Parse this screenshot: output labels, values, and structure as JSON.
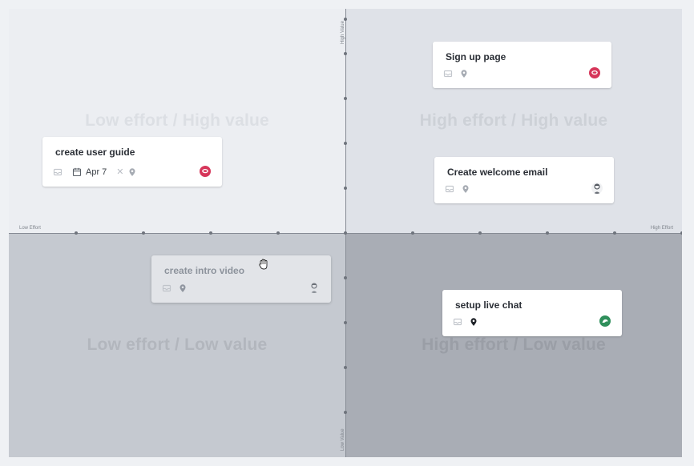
{
  "axes": {
    "left": "Low Effort",
    "right": "High Effort",
    "top": "High Value",
    "bottom": "Low Value"
  },
  "quadrants": {
    "top_left": "Low effort / High value",
    "top_right": "High effort / High value",
    "bottom_left": "Low effort / Low value",
    "bottom_right": "High effort / Low value"
  },
  "cards": {
    "sign_up": {
      "title": "Sign up page",
      "avatar": "red-chat-avatar"
    },
    "user_guide": {
      "title": "create user guide",
      "date": "Apr 7",
      "avatar": "red-chat-avatar"
    },
    "welcome_email": {
      "title": "Create welcome email",
      "avatar": "person-avatar"
    },
    "intro_video": {
      "title": "create intro video",
      "avatar": "person-avatar",
      "state": "dragging"
    },
    "live_chat": {
      "title": "setup live chat",
      "avatar": "green-avatar"
    }
  },
  "colors": {
    "red_avatar": "#d6365a",
    "green_avatar": "#2f8f5b",
    "axis": "#868b94"
  }
}
